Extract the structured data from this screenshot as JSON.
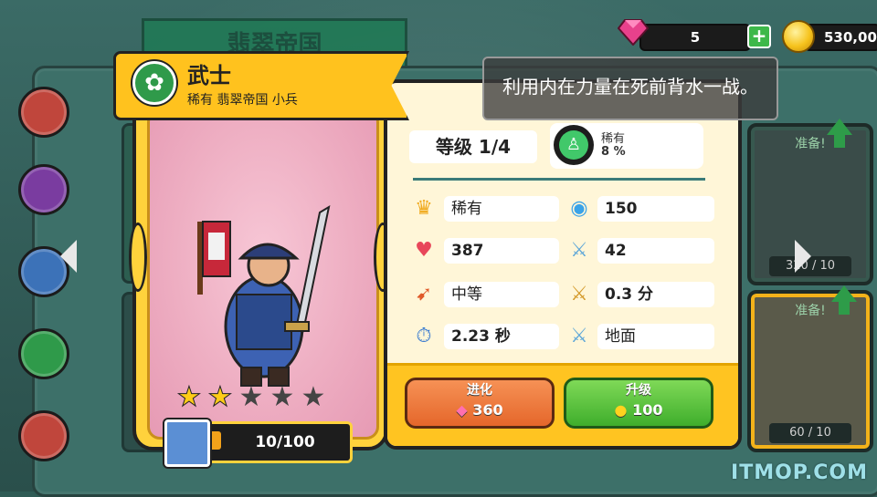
{
  "background": {
    "title": "翡翠帝国",
    "right_cards": [
      {
        "label": "准备!",
        "count": "320 / 10"
      },
      {
        "label": "准备!",
        "count": "60 / 10"
      }
    ]
  },
  "currency": {
    "gems": "5",
    "coins": "530,00"
  },
  "unit": {
    "name": "武士",
    "subtitle": "稀有 翡翠帝国 小兵",
    "stars_filled": 2,
    "stars_total": 5,
    "progress_text": "10/100",
    "progress_fraction": 0.1
  },
  "tooltip": "利用内在力量在死前背水一战。",
  "level": {
    "label": "等级 1/4",
    "rarity_name": "稀有",
    "rarity_percent": "8 %"
  },
  "stats": [
    {
      "icon": "crown-icon",
      "value": "稀有"
    },
    {
      "icon": "mana-orb-icon",
      "value": "150"
    },
    {
      "icon": "heart-icon",
      "value": "387"
    },
    {
      "icon": "sword-icon",
      "value": "42"
    },
    {
      "icon": "speed-boot-icon",
      "value": "中等"
    },
    {
      "icon": "attack-speed-icon",
      "value": "0.3 分"
    },
    {
      "icon": "sword-timer-icon",
      "value": "2.23 秒"
    },
    {
      "icon": "target-type-icon",
      "value": "地面"
    }
  ],
  "buttons": {
    "evolve_label": "进化",
    "evolve_cost": "360",
    "upgrade_label": "升级",
    "upgrade_cost": "100"
  },
  "watermark": "ITMOP.COM",
  "colors": {
    "ribbon": "#ffc21e",
    "evolve_button": "#f07a3c",
    "upgrade_button": "#4fc23a",
    "background": "#3d7069"
  }
}
